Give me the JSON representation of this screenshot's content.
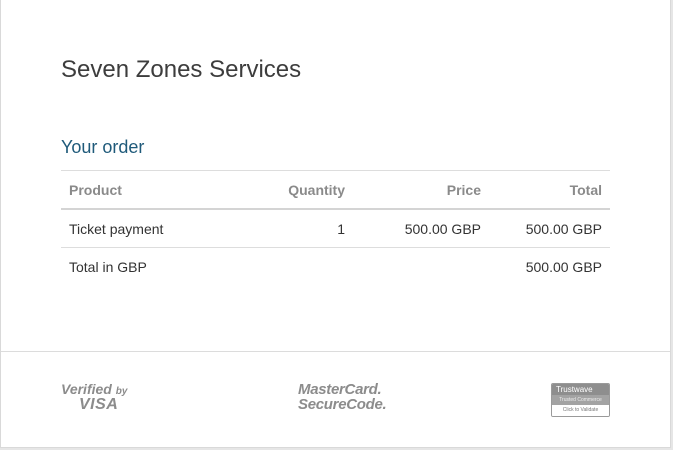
{
  "merchant": {
    "name": "Seven Zones Services"
  },
  "order": {
    "title": "Your order",
    "headers": {
      "product": "Product",
      "quantity": "Quantity",
      "price": "Price",
      "total": "Total"
    },
    "items": [
      {
        "product": "Ticket payment",
        "quantity": "1",
        "price": "500.00 GBP",
        "total": "500.00 GBP"
      }
    ],
    "summary": {
      "label": "Total in GBP",
      "total": "500.00 GBP"
    }
  },
  "footer": {
    "visa": {
      "line1": "Verified",
      "line1_small": "by",
      "line2": "VISA"
    },
    "mastercard": {
      "line1": "MasterCard.",
      "line2": "SecureCode."
    },
    "trustwave": {
      "line1": "Trustwave",
      "line2": "Trusted Commerce",
      "line3": "Click to Validate"
    }
  }
}
